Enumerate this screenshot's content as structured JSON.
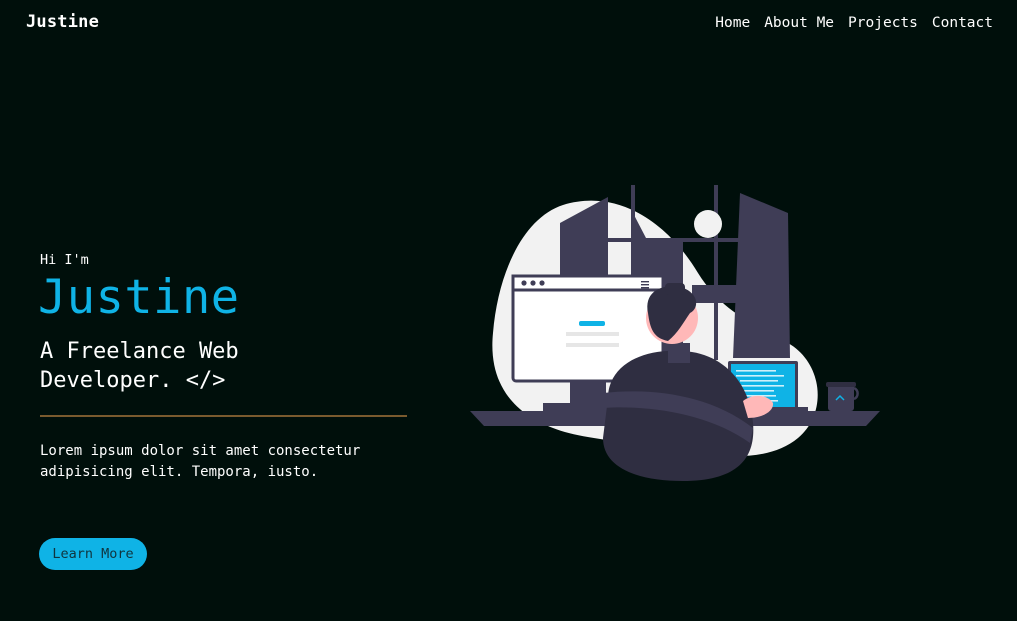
{
  "nav": {
    "logo": "Justine",
    "links": [
      "Home",
      "About Me",
      "Projects",
      "Contact"
    ]
  },
  "hero": {
    "greeting": "Hi I'm",
    "name": "Justine",
    "tagline": "A Freelance Web Developer. </>",
    "description": "Lorem ipsum dolor sit amet consectetur adipisicing elit. Tempora, iusto.",
    "cta_label": "Learn More"
  },
  "colors": {
    "background": "#000f0b",
    "accent": "#0fb3e6",
    "divider": "#7a5a2e",
    "illustration_dark": "#3f3d56"
  },
  "icons": [
    "developer-illustration",
    "browser-window-icon",
    "laptop-icon",
    "coffee-cup-icon"
  ]
}
